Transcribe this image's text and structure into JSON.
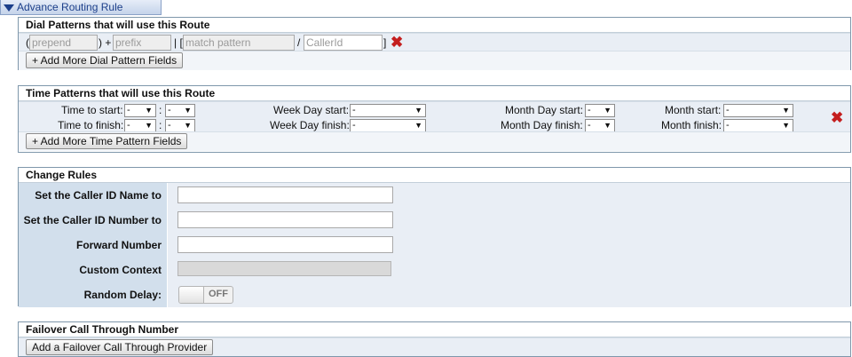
{
  "tab": {
    "label": "Advance Routing Rule"
  },
  "dial": {
    "title": "Dial Patterns that will use this Route",
    "prepend_placeholder": "prepend",
    "prefix_placeholder": "prefix",
    "match_placeholder": "match pattern",
    "callerid_placeholder": "CallerId",
    "paren_open": "(",
    "paren_close_plus": ") +",
    "pipe_bracket": "| [",
    "slash": "/",
    "bracket_close": "]",
    "add_button": "+ Add More Dial Pattern Fields"
  },
  "time": {
    "title": "Time Patterns that will use this Route",
    "time_start_label": "Time to start:",
    "time_finish_label": "Time to finish:",
    "week_start_label": "Week Day start:",
    "week_finish_label": "Week Day finish:",
    "mday_start_label": "Month Day start:",
    "mday_finish_label": "Month Day finish:",
    "month_start_label": "Month start:",
    "month_finish_label": "Month finish:",
    "colon": ":",
    "select_value": "-",
    "add_button": "+ Add More Time Pattern Fields"
  },
  "change": {
    "title": "Change Rules",
    "rows": [
      {
        "label": "Set the Caller ID Name to"
      },
      {
        "label": "Set the Caller ID Number to"
      },
      {
        "label": "Forward Number"
      },
      {
        "label": "Custom Context"
      },
      {
        "label": "Random Delay:"
      }
    ],
    "toggle_state": "OFF"
  },
  "failover": {
    "title": "Failover Call Through Number",
    "add_button": "Add a Failover Call Through Provider"
  },
  "colors": {
    "accent": "#1c3f8a",
    "delete": "#c41e1e",
    "label_bg": "#d2dfec",
    "row_bg": "#e9eef5"
  },
  "icons": {
    "collapse": "triangle-down-icon",
    "delete": "red-x-icon",
    "dropdown": "chevron-down-icon"
  }
}
